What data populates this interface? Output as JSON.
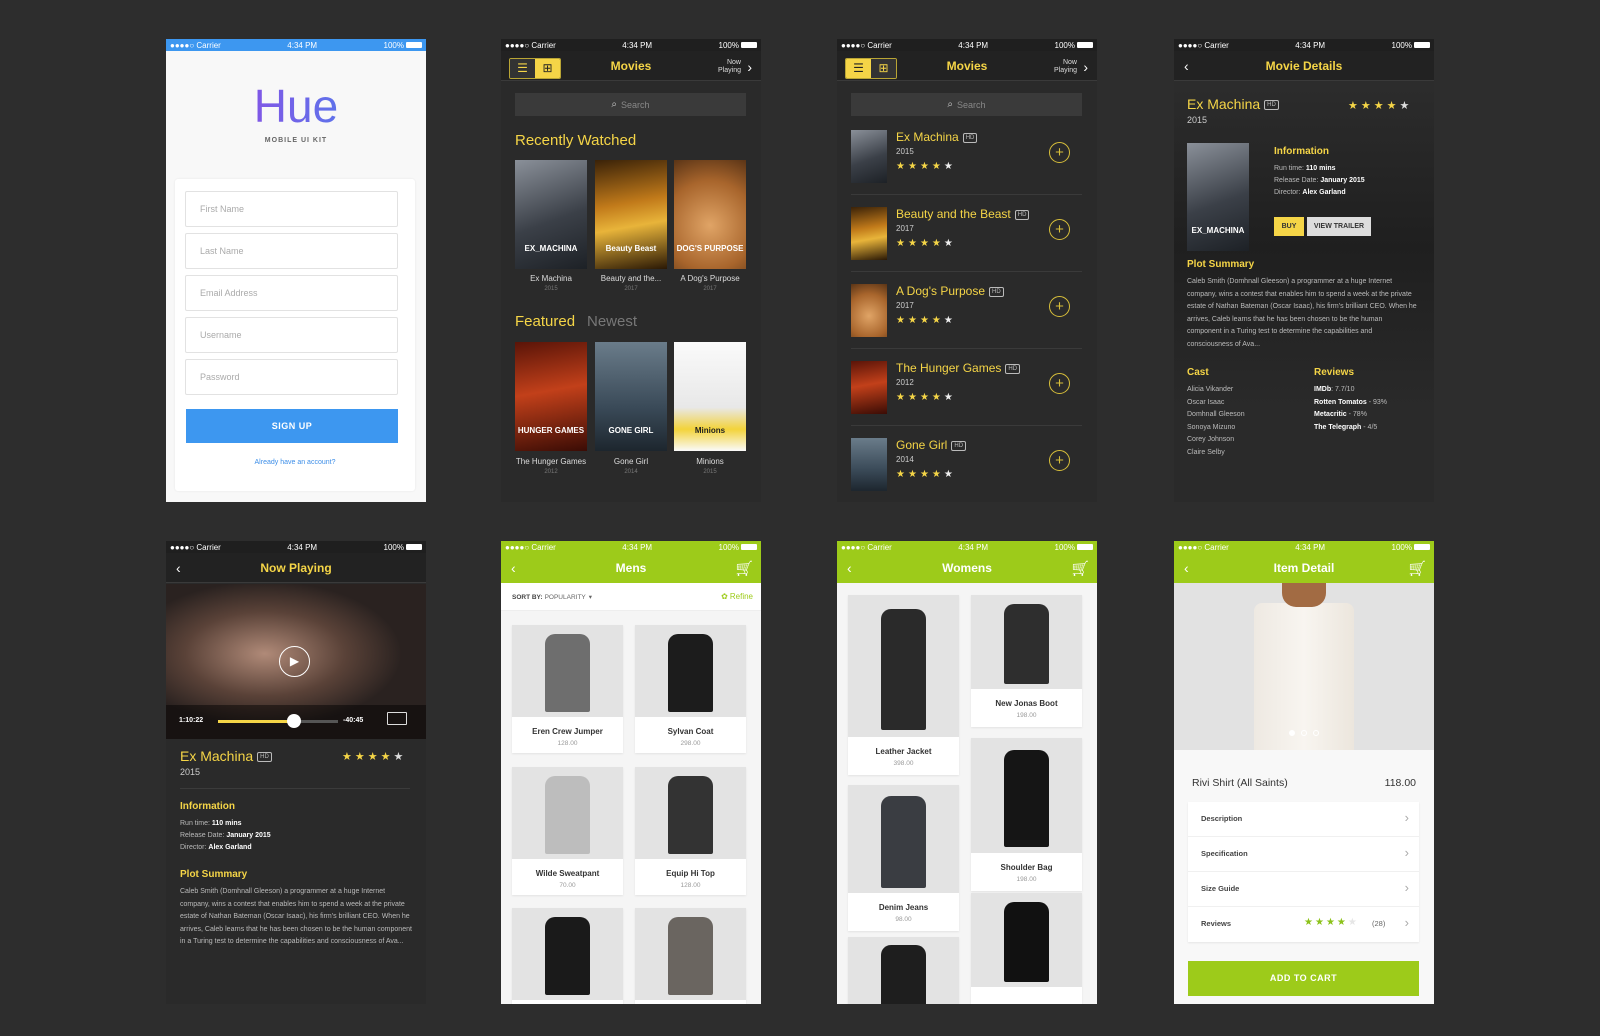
{
  "status": {
    "carrier": "●●●●○ Carrier",
    "time": "4:34 PM",
    "battery": "100%"
  },
  "colors": {
    "yellow": "#f5d547",
    "green": "#9dcb1a",
    "blue": "#3d97f0",
    "dark": "#2a2a2a"
  },
  "login": {
    "logo": "Hue",
    "subtitle": "MOBILE UI KIT",
    "fields": [
      "First Name",
      "Last Name",
      "Email Address",
      "Username",
      "Password"
    ],
    "button": "SIGN UP",
    "link": "Already have an account?"
  },
  "movies_grid": {
    "title": "Movies",
    "now_playing": [
      "Now",
      "Playing"
    ],
    "search_placeholder": "Search",
    "section": "Recently Watched",
    "recent": [
      {
        "title": "Ex Machina",
        "year": "2015",
        "poster": "EX_MACHINA"
      },
      {
        "title": "Beauty and the...",
        "year": "2017",
        "poster": "Beauty Beast"
      },
      {
        "title": "A Dog's Purpose",
        "year": "2017",
        "poster": "DOG'S PURPOSE"
      }
    ],
    "tabs": [
      "Featured",
      "Newest"
    ],
    "featured": [
      {
        "title": "The Hunger Games",
        "year": "2012",
        "poster": "HUNGER GAMES"
      },
      {
        "title": "Gone Girl",
        "year": "2014",
        "poster": "GONE GIRL"
      },
      {
        "title": "Minions",
        "year": "2015",
        "poster": "Minions"
      }
    ]
  },
  "movies_list": {
    "title": "Movies",
    "now_playing": [
      "Now",
      "Playing"
    ],
    "search_placeholder": "Search",
    "hd": "HD",
    "items": [
      {
        "title": "Ex Machina",
        "year": "2015",
        "rating": 4
      },
      {
        "title": "Beauty and the Beast",
        "year": "2017",
        "rating": 4
      },
      {
        "title": "A Dog's Purpose",
        "year": "2017",
        "rating": 4
      },
      {
        "title": "The Hunger Games",
        "year": "2012",
        "rating": 4
      },
      {
        "title": "Gone Girl",
        "year": "2014",
        "rating": 4
      }
    ]
  },
  "movie_details": {
    "title": "Movie Details",
    "movie": "Ex Machina",
    "hd": "HD",
    "year": "2015",
    "rating": 4,
    "poster": "EX_MACHINA",
    "info_heading": "Information",
    "info": [
      {
        "label": "Run time: ",
        "value": "110 mins"
      },
      {
        "label": "Release Date: ",
        "value": "January 2015"
      },
      {
        "label": "Director: ",
        "value": "Alex Garland"
      }
    ],
    "buy": "BUY",
    "trailer": "VIEW TRAILER",
    "plot_heading": "Plot Summary",
    "plot": "Caleb Smith (Domhnall Gleeson) a programmer at a huge Internet company, wins a contest that enables him to spend a week at the private estate of Nathan Bateman (Oscar Isaac), his firm's brilliant CEO. When he arrives, Caleb learns that he has been chosen to be the human component in a Turing test to determine the capabilities and consciousness of Ava...",
    "cast_heading": "Cast",
    "cast": [
      "Alicia Vikander",
      "Oscar Isaac",
      "Domhnall Gleeson",
      "Sonoya Mizuno",
      "Corey Johnson",
      "Claire Selby"
    ],
    "reviews_heading": "Reviews",
    "reviews": [
      {
        "source": "IMDb",
        "score": ": 7.7/10"
      },
      {
        "source": "Rotten Tomatos",
        "score": " - 93%"
      },
      {
        "source": "Metacritic",
        "score": " - 78%"
      },
      {
        "source": "The Telegraph",
        "score": " - 4/5"
      }
    ]
  },
  "now_playing": {
    "title": "Now Playing",
    "elapsed": "1:10:22",
    "remaining": "-40:45",
    "progress": 0.63,
    "movie": "Ex Machina",
    "hd": "HD",
    "year": "2015",
    "rating": 4,
    "info_heading": "Information",
    "info": [
      {
        "label": "Run time: ",
        "value": "110 mins"
      },
      {
        "label": "Release Date: ",
        "value": "January 2015"
      },
      {
        "label": "Director: ",
        "value": "Alex Garland"
      }
    ],
    "plot_heading": "Plot Summary",
    "plot": "Caleb Smith (Domhnall Gleeson) a programmer at a huge Internet company, wins a contest that enables him to spend a week at the private estate of Nathan Bateman (Oscar Isaac), his firm's brilliant CEO. When he arrives, Caleb learns that he has been chosen to be the human component in a Turing test to determine the capabilities and consciousness of Ava..."
  },
  "mens": {
    "title": "Mens",
    "sort_label": "SORT BY:",
    "sort_value": "POPULARITY",
    "refine": "Refine",
    "products": [
      {
        "name": "Eren Crew Jumper",
        "price": "128.00"
      },
      {
        "name": "Sylvan Coat",
        "price": "298.00"
      },
      {
        "name": "Wilde Sweatpant",
        "price": "70.00"
      },
      {
        "name": "Equip Hi Top",
        "price": "128.00"
      },
      {
        "name": "",
        "price": ""
      },
      {
        "name": "",
        "price": ""
      }
    ]
  },
  "womens": {
    "title": "Womens",
    "products": [
      {
        "name": "Leather Jacket",
        "price": "398.00"
      },
      {
        "name": "New Jonas Boot",
        "price": "198.00"
      },
      {
        "name": "Denim Jeans",
        "price": "98.00"
      },
      {
        "name": "Shoulder Bag",
        "price": "198.00"
      },
      {
        "name": "",
        "price": ""
      },
      {
        "name": "",
        "price": ""
      }
    ]
  },
  "item_detail": {
    "title": "Item Detail",
    "carousel_count": 3,
    "carousel_active": 0,
    "name": "Rivi Shirt (All Saints)",
    "price": "118.00",
    "rows": [
      "Description",
      "Specification",
      "Size Guide",
      "Reviews"
    ],
    "review_rating": 4,
    "review_count": "(28)",
    "button": "ADD TO CART"
  }
}
